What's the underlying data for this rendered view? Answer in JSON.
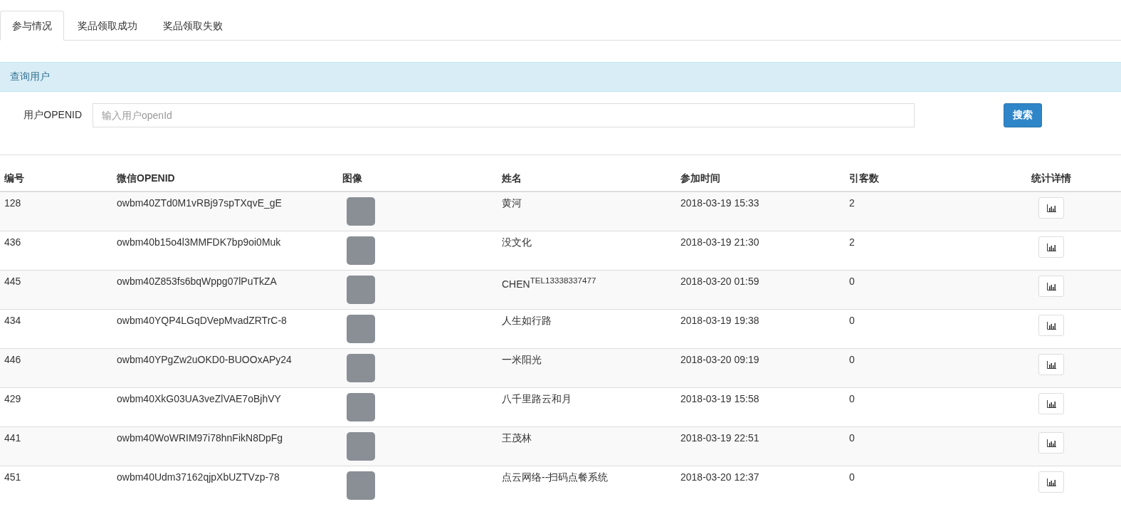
{
  "tabs": [
    {
      "label": "参与情况",
      "selected": true
    },
    {
      "label": "奖品领取成功",
      "selected": false
    },
    {
      "label": "奖品领取失败",
      "selected": false
    }
  ],
  "panel": {
    "heading": "查询用户"
  },
  "search": {
    "label": "用户OPENID",
    "placeholder": "输入用户openId",
    "button": "搜索"
  },
  "table": {
    "columns": [
      "编号",
      "微信OPENID",
      "图像",
      "姓名",
      "参加时间",
      "引客数",
      "统计详情"
    ],
    "rows": [
      {
        "id": "128",
        "openid": "owbm40ZTd0M1vRBj97spTXqvE_gE",
        "name": "黄河",
        "time": "2018-03-19 15:33",
        "count": "2"
      },
      {
        "id": "436",
        "openid": "owbm40b15o4l3MMFDK7bp9oi0Muk",
        "name": "没文化",
        "time": "2018-03-19 21:30",
        "count": "2"
      },
      {
        "id": "445",
        "openid": "owbm40Z853fs6bqWppg07lPuTkZA",
        "name": "CHEN$^{TEL13338337477}$",
        "time": "2018-03-20 01:59",
        "count": "0"
      },
      {
        "id": "434",
        "openid": "owbm40YQP4LGqDVepMvadZRTrC-8",
        "name": "人生如行路",
        "time": "2018-03-19 19:38",
        "count": "0"
      },
      {
        "id": "446",
        "openid": "owbm40YPgZw2uOKD0-BUOOxAPy24",
        "name": "一米阳光",
        "time": "2018-03-20 09:19",
        "count": "0"
      },
      {
        "id": "429",
        "openid": "owbm40XkG03UA3veZlVAE7oBjhVY",
        "name": "八千里路云和月",
        "time": "2018-03-19 15:58",
        "count": "0"
      },
      {
        "id": "441",
        "openid": "owbm40WoWRIM97i78hnFikN8DpFg",
        "name": "王茂林",
        "time": "2018-03-19 22:51",
        "count": "0"
      },
      {
        "id": "451",
        "openid": "owbm40Udm37162qjpXbUZTVzp-78",
        "name": "点云网络--扫码点餐系统",
        "time": "2018-03-20 12:37",
        "count": "0"
      }
    ]
  }
}
